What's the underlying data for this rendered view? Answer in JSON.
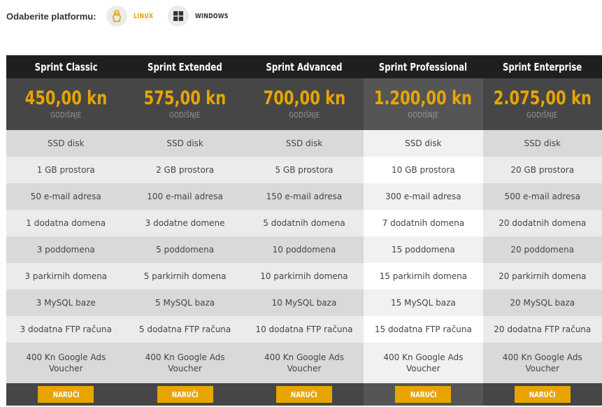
{
  "platform": {
    "label": "Odaberite platformu:",
    "options": [
      {
        "name": "LINUX",
        "icon": "linux-icon",
        "selected": true
      },
      {
        "name": "WINDOWS",
        "icon": "windows-icon",
        "selected": false
      }
    ]
  },
  "colors": {
    "accent": "#e8a500",
    "header_bg": "#1f1f1f",
    "price_bg": "#464646"
  },
  "plans": [
    {
      "name": "Sprint Classic",
      "price": "450,00 kn",
      "period": "GODIŠNJE",
      "features": [
        "SSD disk",
        "1 GB prostora",
        "50 e-mail adresa",
        "1 dodatna domena",
        "3 poddomena",
        "3 parkirnih domena",
        "3 MySQL baze",
        "3 dodatna FTP računa",
        "400 Kn Google Ads Voucher"
      ],
      "button": "NARUČI"
    },
    {
      "name": "Sprint Extended",
      "price": "575,00 kn",
      "period": "GODIŠNJE",
      "features": [
        "SSD disk",
        "2 GB prostora",
        "100 e-mail adresa",
        "3 dodatne domene",
        "5 poddomena",
        "5 parkirnih domena",
        "5 MySQL baza",
        "5 dodatna FTP računa",
        "400 Kn Google Ads Voucher"
      ],
      "button": "NARUČI"
    },
    {
      "name": "Sprint Advanced",
      "price": "700,00 kn",
      "period": "GODIŠNJE",
      "features": [
        "SSD disk",
        "5 GB prostora",
        "150 e-mail adresa",
        "5 dodatnih domena",
        "10 poddomena",
        "10 parkirnih domena",
        "10 MySQL baza",
        "10 dodatna FTP računa",
        "400 Kn Google Ads Voucher"
      ],
      "button": "NARUČI"
    },
    {
      "name": "Sprint Professional",
      "price": "1.200,00 kn",
      "period": "GODIŠNJE",
      "features": [
        "SSD disk",
        "10 GB prostora",
        "300 e-mail adresa",
        "7 dodatnih domena",
        "15 poddomena",
        "15 parkirnih domena",
        "15 MySQL baza",
        "15 dodatna FTP računa",
        "400 Kn Google Ads Voucher"
      ],
      "button": "NARUČI",
      "featured": true
    },
    {
      "name": "Sprint Enterprise",
      "price": "2.075,00 kn",
      "period": "GODIŠNJE",
      "features": [
        "SSD disk",
        "20 GB prostora",
        "500 e-mail adresa",
        "20 dodatnih domena",
        "20 poddomena",
        "20 parkirnih domena",
        "20 MySQL baza",
        "20 dodatna FTP računa",
        "400 Kn Google Ads Voucher"
      ],
      "button": "NARUČI"
    }
  ]
}
